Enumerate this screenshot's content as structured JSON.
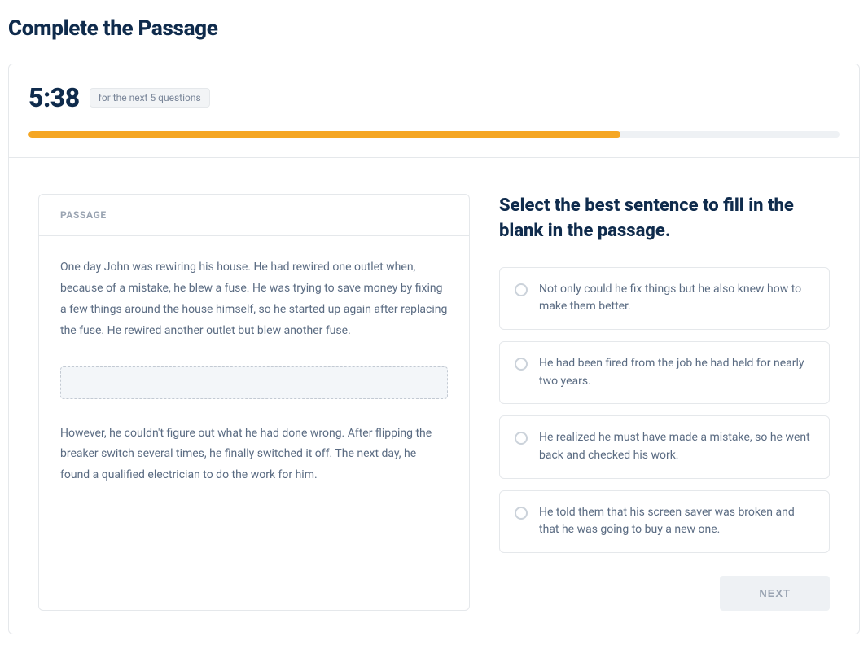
{
  "page_title": "Complete the Passage",
  "timer": {
    "value": "5:38",
    "hint": "for the next 5 questions"
  },
  "progress_percent": 73,
  "passage": {
    "label": "PASSAGE",
    "before": "One day John was rewiring his house. He had rewired one outlet when, because of a mistake, he blew a fuse. He was trying to save money by fixing a few things around the house himself, so he started up again after replacing the fuse. He rewired another outlet but blew another fuse.",
    "after": "However, he couldn't figure out what he had done wrong. After flipping the breaker switch several times, he finally switched it off. The next day, he found a qualified electrician to do the work for him."
  },
  "question": {
    "prompt": "Select the best sentence to fill in the blank in the passage.",
    "options": [
      "Not only could he fix things but he also knew how to make them better.",
      "He had been fired from the job he had held for nearly two years.",
      "He realized he must have made a mistake, so he went back and checked his work.",
      "He told them that his screen saver was broken and that he was going to buy a new one."
    ]
  },
  "next_label": "NEXT"
}
